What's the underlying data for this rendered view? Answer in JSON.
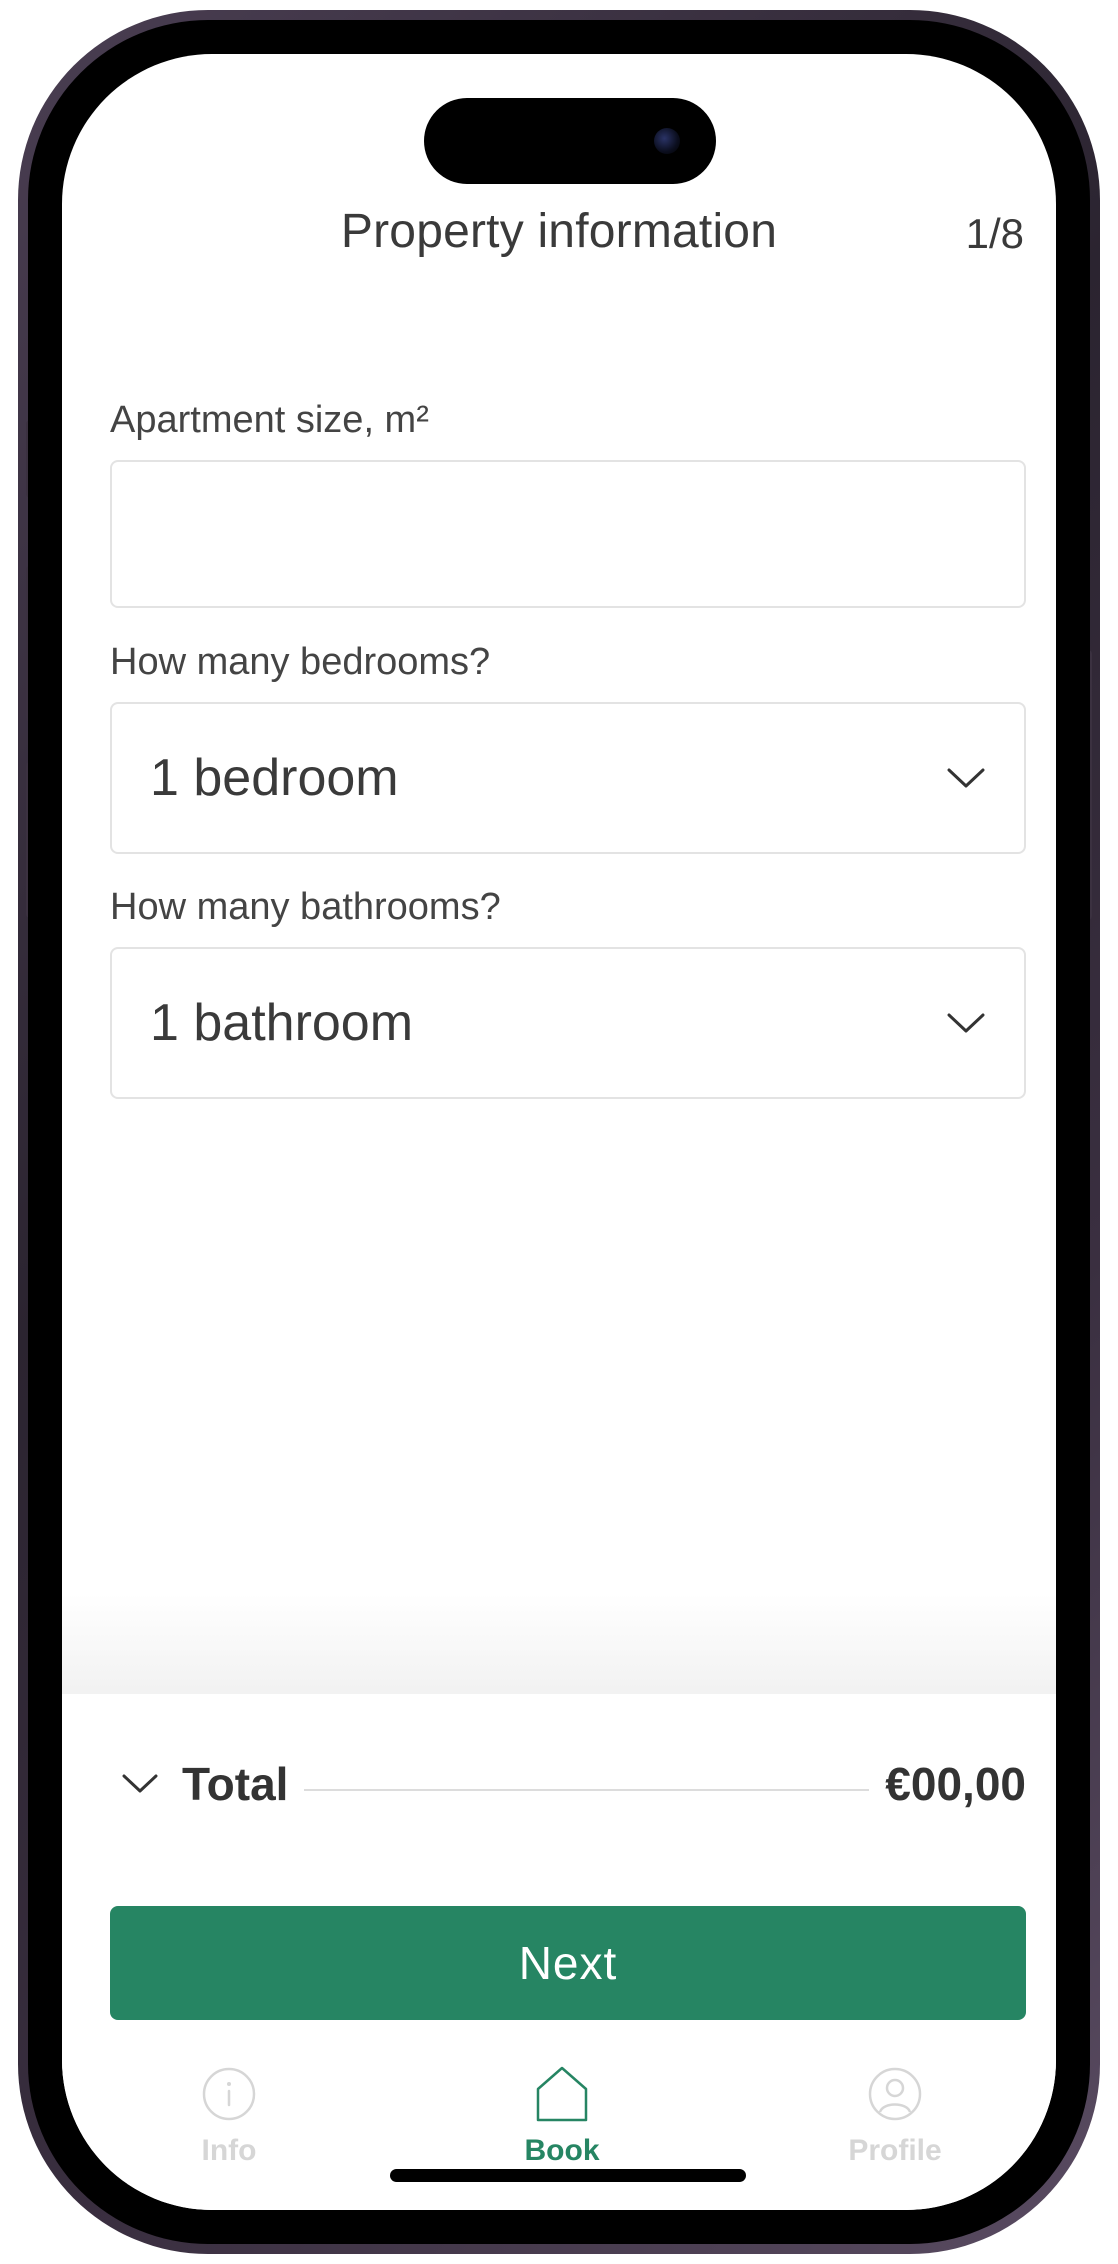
{
  "header": {
    "title": "Property information",
    "step": "1/8"
  },
  "form": {
    "size_label": "Apartment size, m²",
    "size_value": "",
    "size_placeholder": "",
    "bedrooms_label": "How many bedrooms?",
    "bedrooms_value": "1 bedroom",
    "bathrooms_label": "How many bathrooms?",
    "bathrooms_value": "1 bathroom"
  },
  "summary": {
    "total_label": "Total",
    "total_amount": "€00,00"
  },
  "actions": {
    "next_label": "Next"
  },
  "tabbar": {
    "items": [
      {
        "label": "Info",
        "icon": "info-icon",
        "active": false
      },
      {
        "label": "Book",
        "icon": "home-icon",
        "active": true
      },
      {
        "label": "Profile",
        "icon": "profile-icon",
        "active": false
      }
    ]
  },
  "colors": {
    "accent": "#268563",
    "inactive": "#d6d6d6",
    "text": "#3a3a3a",
    "border": "#e3e3e3"
  }
}
